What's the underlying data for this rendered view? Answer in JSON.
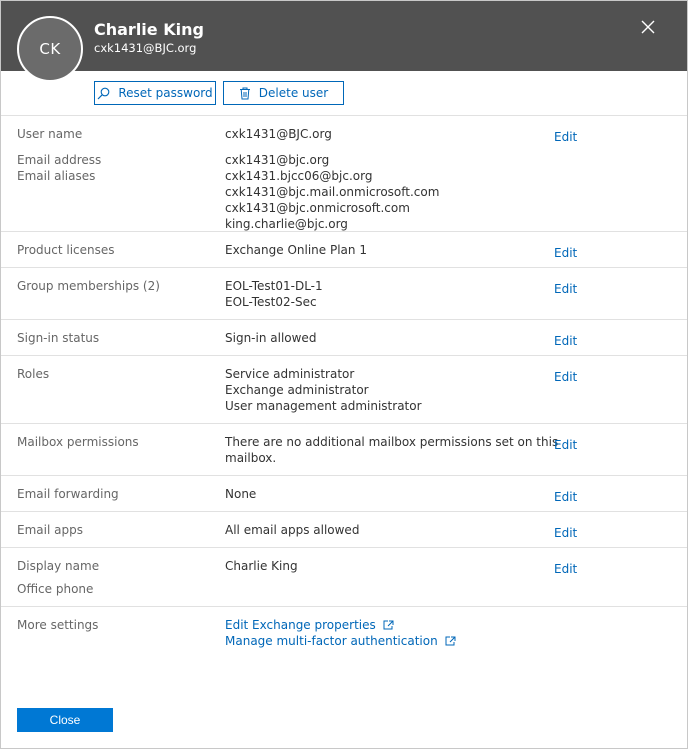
{
  "header": {
    "initials": "CK",
    "name": "Charlie King",
    "email": "cxk1431@BJC.org"
  },
  "toolbar": {
    "reset_label": "Reset password",
    "delete_label": "Delete user"
  },
  "edit_label": "Edit",
  "fields": {
    "user_name": {
      "label": "User name",
      "value": "cxk1431@BJC.org"
    },
    "email": {
      "label": "Email address",
      "aliases_label": "Email aliases",
      "values": [
        "cxk1431@bjc.org",
        "cxk1431.bjcc06@bjc.org",
        "cxk1431@bjc.mail.onmicrosoft.com",
        "cxk1431@bjc.onmicrosoft.com",
        "king.charlie@bjc.org"
      ]
    },
    "licenses": {
      "label": "Product licenses",
      "value": "Exchange Online Plan 1"
    },
    "groups": {
      "label": "Group memberships (2)",
      "values": [
        "EOL-Test01-DL-1",
        "EOL-Test02-Sec"
      ]
    },
    "signin": {
      "label": "Sign-in status",
      "value": "Sign-in allowed"
    },
    "roles": {
      "label": "Roles",
      "values": [
        "Service administrator",
        "Exchange administrator",
        "User management administrator"
      ]
    },
    "mailbox": {
      "label": "Mailbox permissions",
      "values": [
        "There are no additional mailbox permissions set on this",
        "mailbox."
      ]
    },
    "forwarding": {
      "label": "Email forwarding",
      "value": "None"
    },
    "apps": {
      "label": "Email apps",
      "value": "All email apps allowed"
    },
    "display": {
      "label": "Display name",
      "value": "Charlie King",
      "phone_label": "Office phone"
    },
    "more": {
      "label": "More settings",
      "links": [
        "Edit Exchange properties",
        "Manage multi-factor authentication"
      ]
    }
  },
  "footer": {
    "close_label": "Close"
  }
}
